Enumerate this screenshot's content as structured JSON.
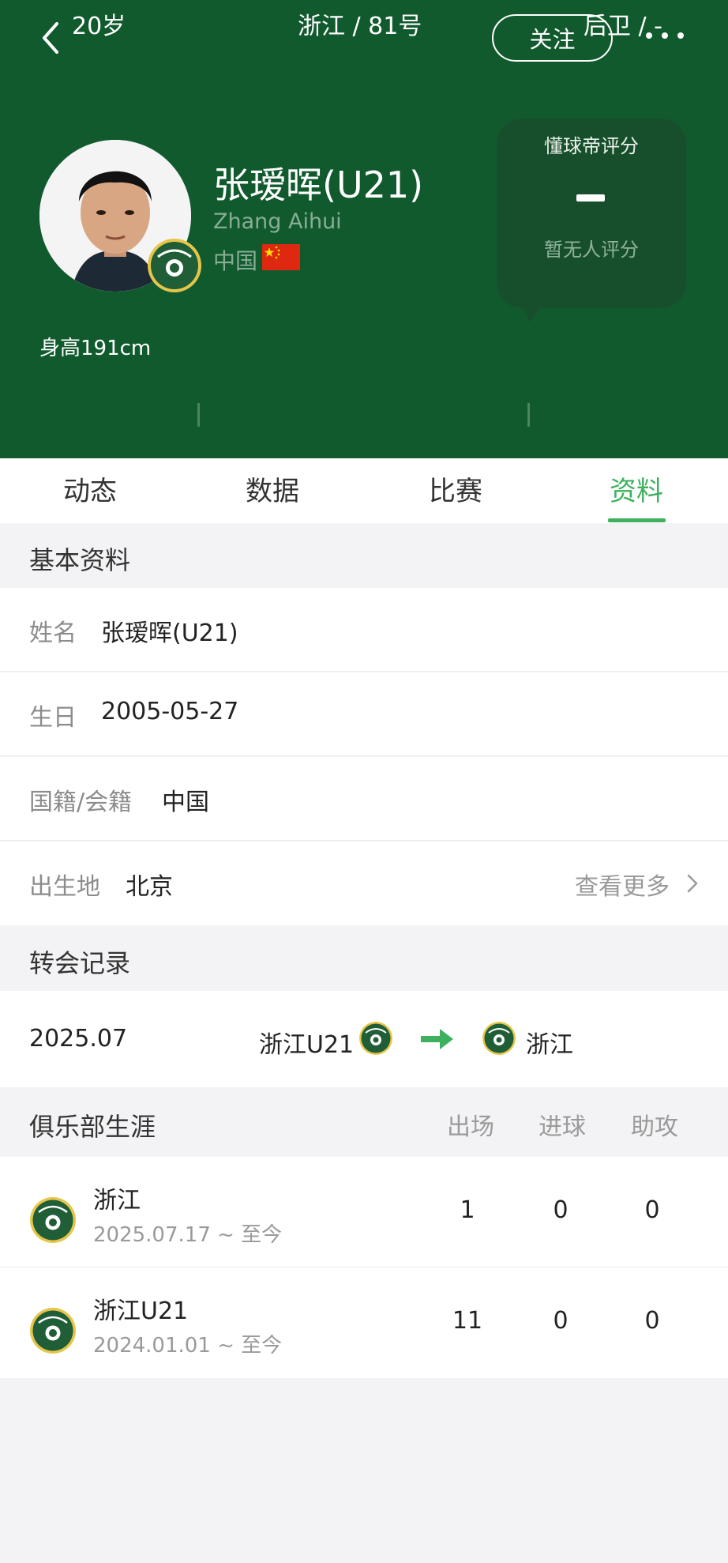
{
  "header": {
    "follow_label": "关注",
    "player_name": "张瑷晖(U21)",
    "player_name_en": "Zhang Aihui",
    "nationality": "中国",
    "height": "身高191cm",
    "rating": {
      "title": "懂球帝评分",
      "value": "-",
      "note": "暂无人评分"
    },
    "stats": {
      "age": "20岁",
      "team_number": "浙江 / 81号",
      "position": "后卫 / -"
    }
  },
  "tabs": [
    {
      "label": "动态"
    },
    {
      "label": "数据"
    },
    {
      "label": "比赛"
    },
    {
      "label": "资料",
      "active": true
    }
  ],
  "basic": {
    "title": "基本资料",
    "rows": [
      {
        "label": "姓名",
        "value": "张瑷晖(U21)"
      },
      {
        "label": "生日",
        "value": "2005-05-27"
      },
      {
        "label": "国籍/会籍",
        "value": "中国"
      },
      {
        "label": "出生地",
        "value": "北京"
      }
    ],
    "see_more": "查看更多"
  },
  "transfers": {
    "title": "转会记录",
    "items": [
      {
        "date": "2025.07",
        "from": "浙江U21",
        "to": "浙江"
      }
    ]
  },
  "career": {
    "title": "俱乐部生涯",
    "columns": [
      "出场",
      "进球",
      "助攻"
    ],
    "rows": [
      {
        "team": "浙江",
        "period": "2025.07.17 ~ 至今",
        "apps": "1",
        "goals": "0",
        "assists": "0"
      },
      {
        "team": "浙江U21",
        "period": "2024.01.01 ~ 至今",
        "apps": "11",
        "goals": "0",
        "assists": "0"
      }
    ]
  },
  "colors": {
    "header_bg": "#115a2e",
    "accent": "#3db15e",
    "club_green": "#1f5e36"
  }
}
